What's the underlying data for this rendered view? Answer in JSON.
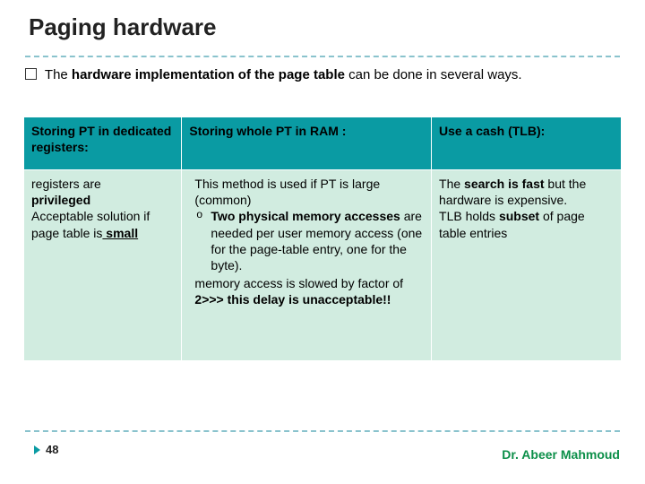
{
  "title": "Paging hardware",
  "intro_prefix": "The ",
  "intro_bold": "hardware implementation of the page table ",
  "intro_suffix": "can be done in several ways.",
  "headers": {
    "c1": "Storing PT in dedicated registers:",
    "c2": "Storing whole PT in RAM  :",
    "c3": "Use a cash (TLB):"
  },
  "body": {
    "c1": {
      "l1_a": "registers are ",
      "l1_b": "privileged",
      "l2_a": "Acceptable solution if page table is",
      "l2_b": " small"
    },
    "c2": {
      "p1": "This method is used if PT is large (common)",
      "bullet_a": "Two physical memory accesses",
      "bullet_b": " are needed per user memory access (one for the page-table entry, one for the byte).",
      "p2_a": "memory access is slowed by factor of ",
      "p2_b": "2>>> this delay is unacceptable!!"
    },
    "c3": {
      "l1_a": "The ",
      "l1_b": "search is fast",
      "l1_c": " but the hardware is expensive.",
      "l2_a": "TLB holds ",
      "l2_b": "subset",
      "l2_c": " of page table entries"
    }
  },
  "page_number": "48",
  "author": "Dr. Abeer Mahmoud"
}
